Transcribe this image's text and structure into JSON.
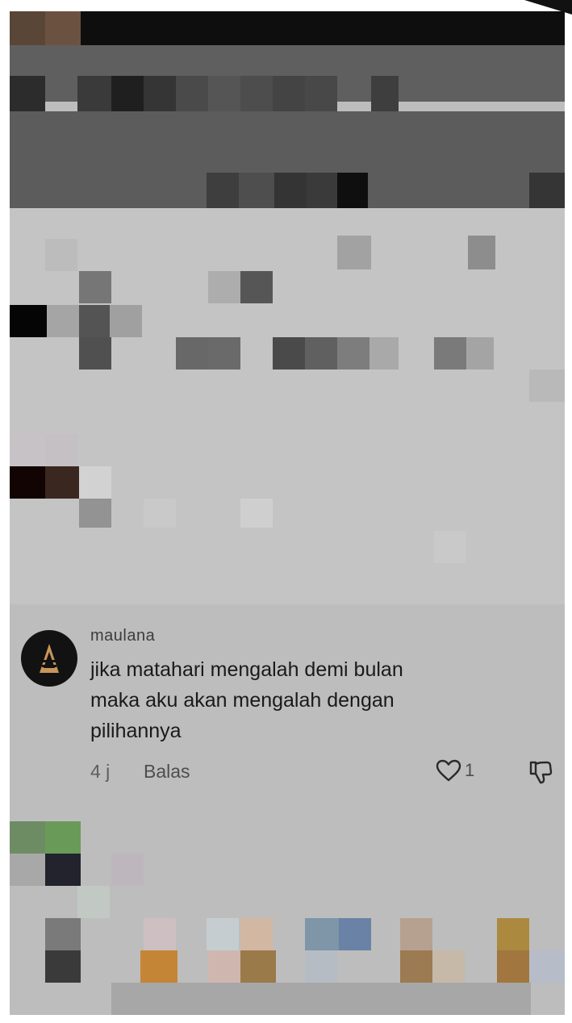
{
  "comment": {
    "username": "maulana",
    "text_lines": [
      "jika matahari mengalah demi bulan",
      "maka aku akan mengalah dengan",
      "pilihannya"
    ],
    "time": "4 j",
    "reply_label": "Balas",
    "like_count": "1",
    "icons": {
      "avatar": "rank-chevron-icon",
      "like": "heart-outline-icon",
      "dislike": "thumbs-down-outline-icon"
    }
  },
  "colors": {
    "background": "#bdbdbd",
    "text_primary": "#1a1a1a",
    "text_secondary": "#5e5e5e",
    "avatar_bg": "#121212",
    "avatar_mark": "#c8955b"
  }
}
